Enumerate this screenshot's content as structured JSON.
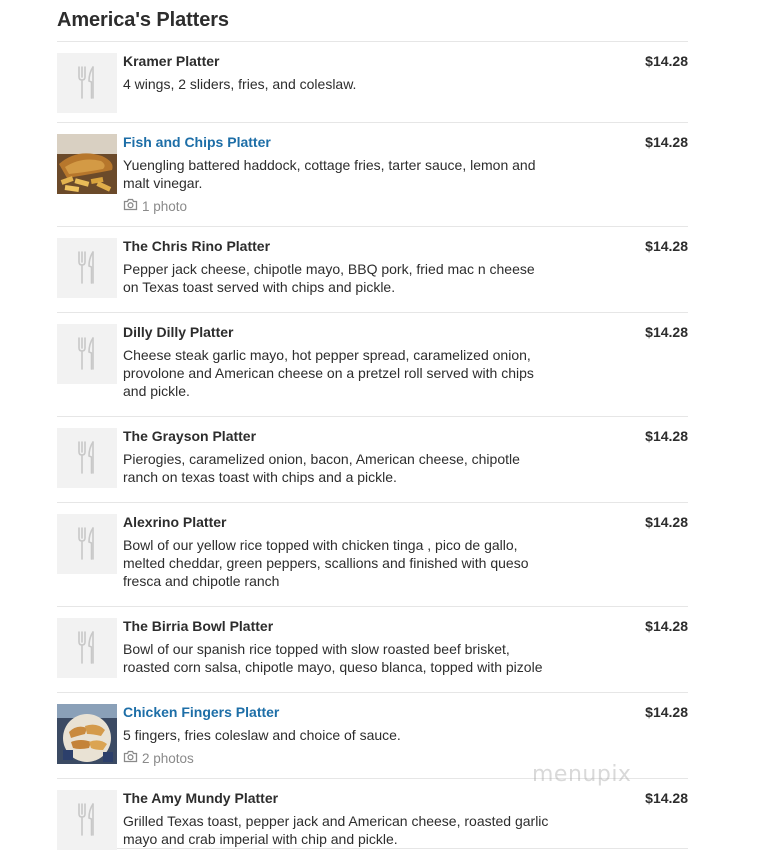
{
  "section": {
    "title": "America's Platters"
  },
  "items": [
    {
      "name": "Kramer Platter",
      "desc": "4 wings, 2 sliders, fries, and coleslaw.",
      "price": "$14.28",
      "link": false,
      "photos": "",
      "thumb": "placeholder"
    },
    {
      "name": "Fish and Chips Platter",
      "desc": "Yuengling battered haddock, cottage fries, tarter sauce, lemon and malt vinegar.",
      "price": "$14.28",
      "link": true,
      "photos": "1 photo",
      "thumb": "fish"
    },
    {
      "name": "The Chris Rino Platter",
      "desc": "Pepper jack cheese, chipotle mayo, BBQ pork, fried mac n cheese on Texas toast served with chips and pickle.",
      "price": "$14.28",
      "link": false,
      "photos": "",
      "thumb": "placeholder"
    },
    {
      "name": "Dilly Dilly Platter",
      "desc": "Cheese steak garlic mayo, hot pepper spread, caramelized onion, provolone and American cheese on a pretzel roll served with chips and pickle.",
      "price": "$14.28",
      "link": false,
      "photos": "",
      "thumb": "placeholder"
    },
    {
      "name": "The Grayson Platter",
      "desc": "Pierogies, caramelized onion, bacon, American cheese, chipotle ranch on texas toast with chips and a pickle.",
      "price": "$14.28",
      "link": false,
      "photos": "",
      "thumb": "placeholder"
    },
    {
      "name": "Alexrino Platter",
      "desc": "Bowl of our yellow rice topped with chicken tinga , pico de gallo, melted cheddar, green peppers, scallions and finished with queso fresca and chipotle ranch",
      "price": "$14.28",
      "link": false,
      "photos": "",
      "thumb": "placeholder"
    },
    {
      "name": "The Birria Bowl Platter",
      "desc": "Bowl of our spanish rice topped with slow roasted beef brisket, roasted corn salsa, chipotle mayo, queso blanca, topped with pizole",
      "price": "$14.28",
      "link": false,
      "photos": "",
      "thumb": "placeholder"
    },
    {
      "name": "Chicken Fingers Platter",
      "desc": "5 fingers, fries coleslaw and choice of sauce.",
      "price": "$14.28",
      "link": true,
      "photos": "2 photos",
      "thumb": "chicken"
    },
    {
      "name": "The Amy Mundy Platter",
      "desc": "Grilled Texas toast, pepper jack and American cheese, roasted garlic mayo and crab imperial with chip and pickle.",
      "price": "$14.28",
      "link": false,
      "photos": "",
      "thumb": "placeholder"
    }
  ],
  "watermark": "menupix",
  "icons": {
    "placeholder": "fork-knife-icon",
    "photos": "camera-icon"
  },
  "colors": {
    "link": "#1d6ea7",
    "text": "#2d2d2d",
    "muted": "#8a8a8a",
    "divider": "#e6e6e6",
    "thumb_bg": "#f2f2f2"
  }
}
